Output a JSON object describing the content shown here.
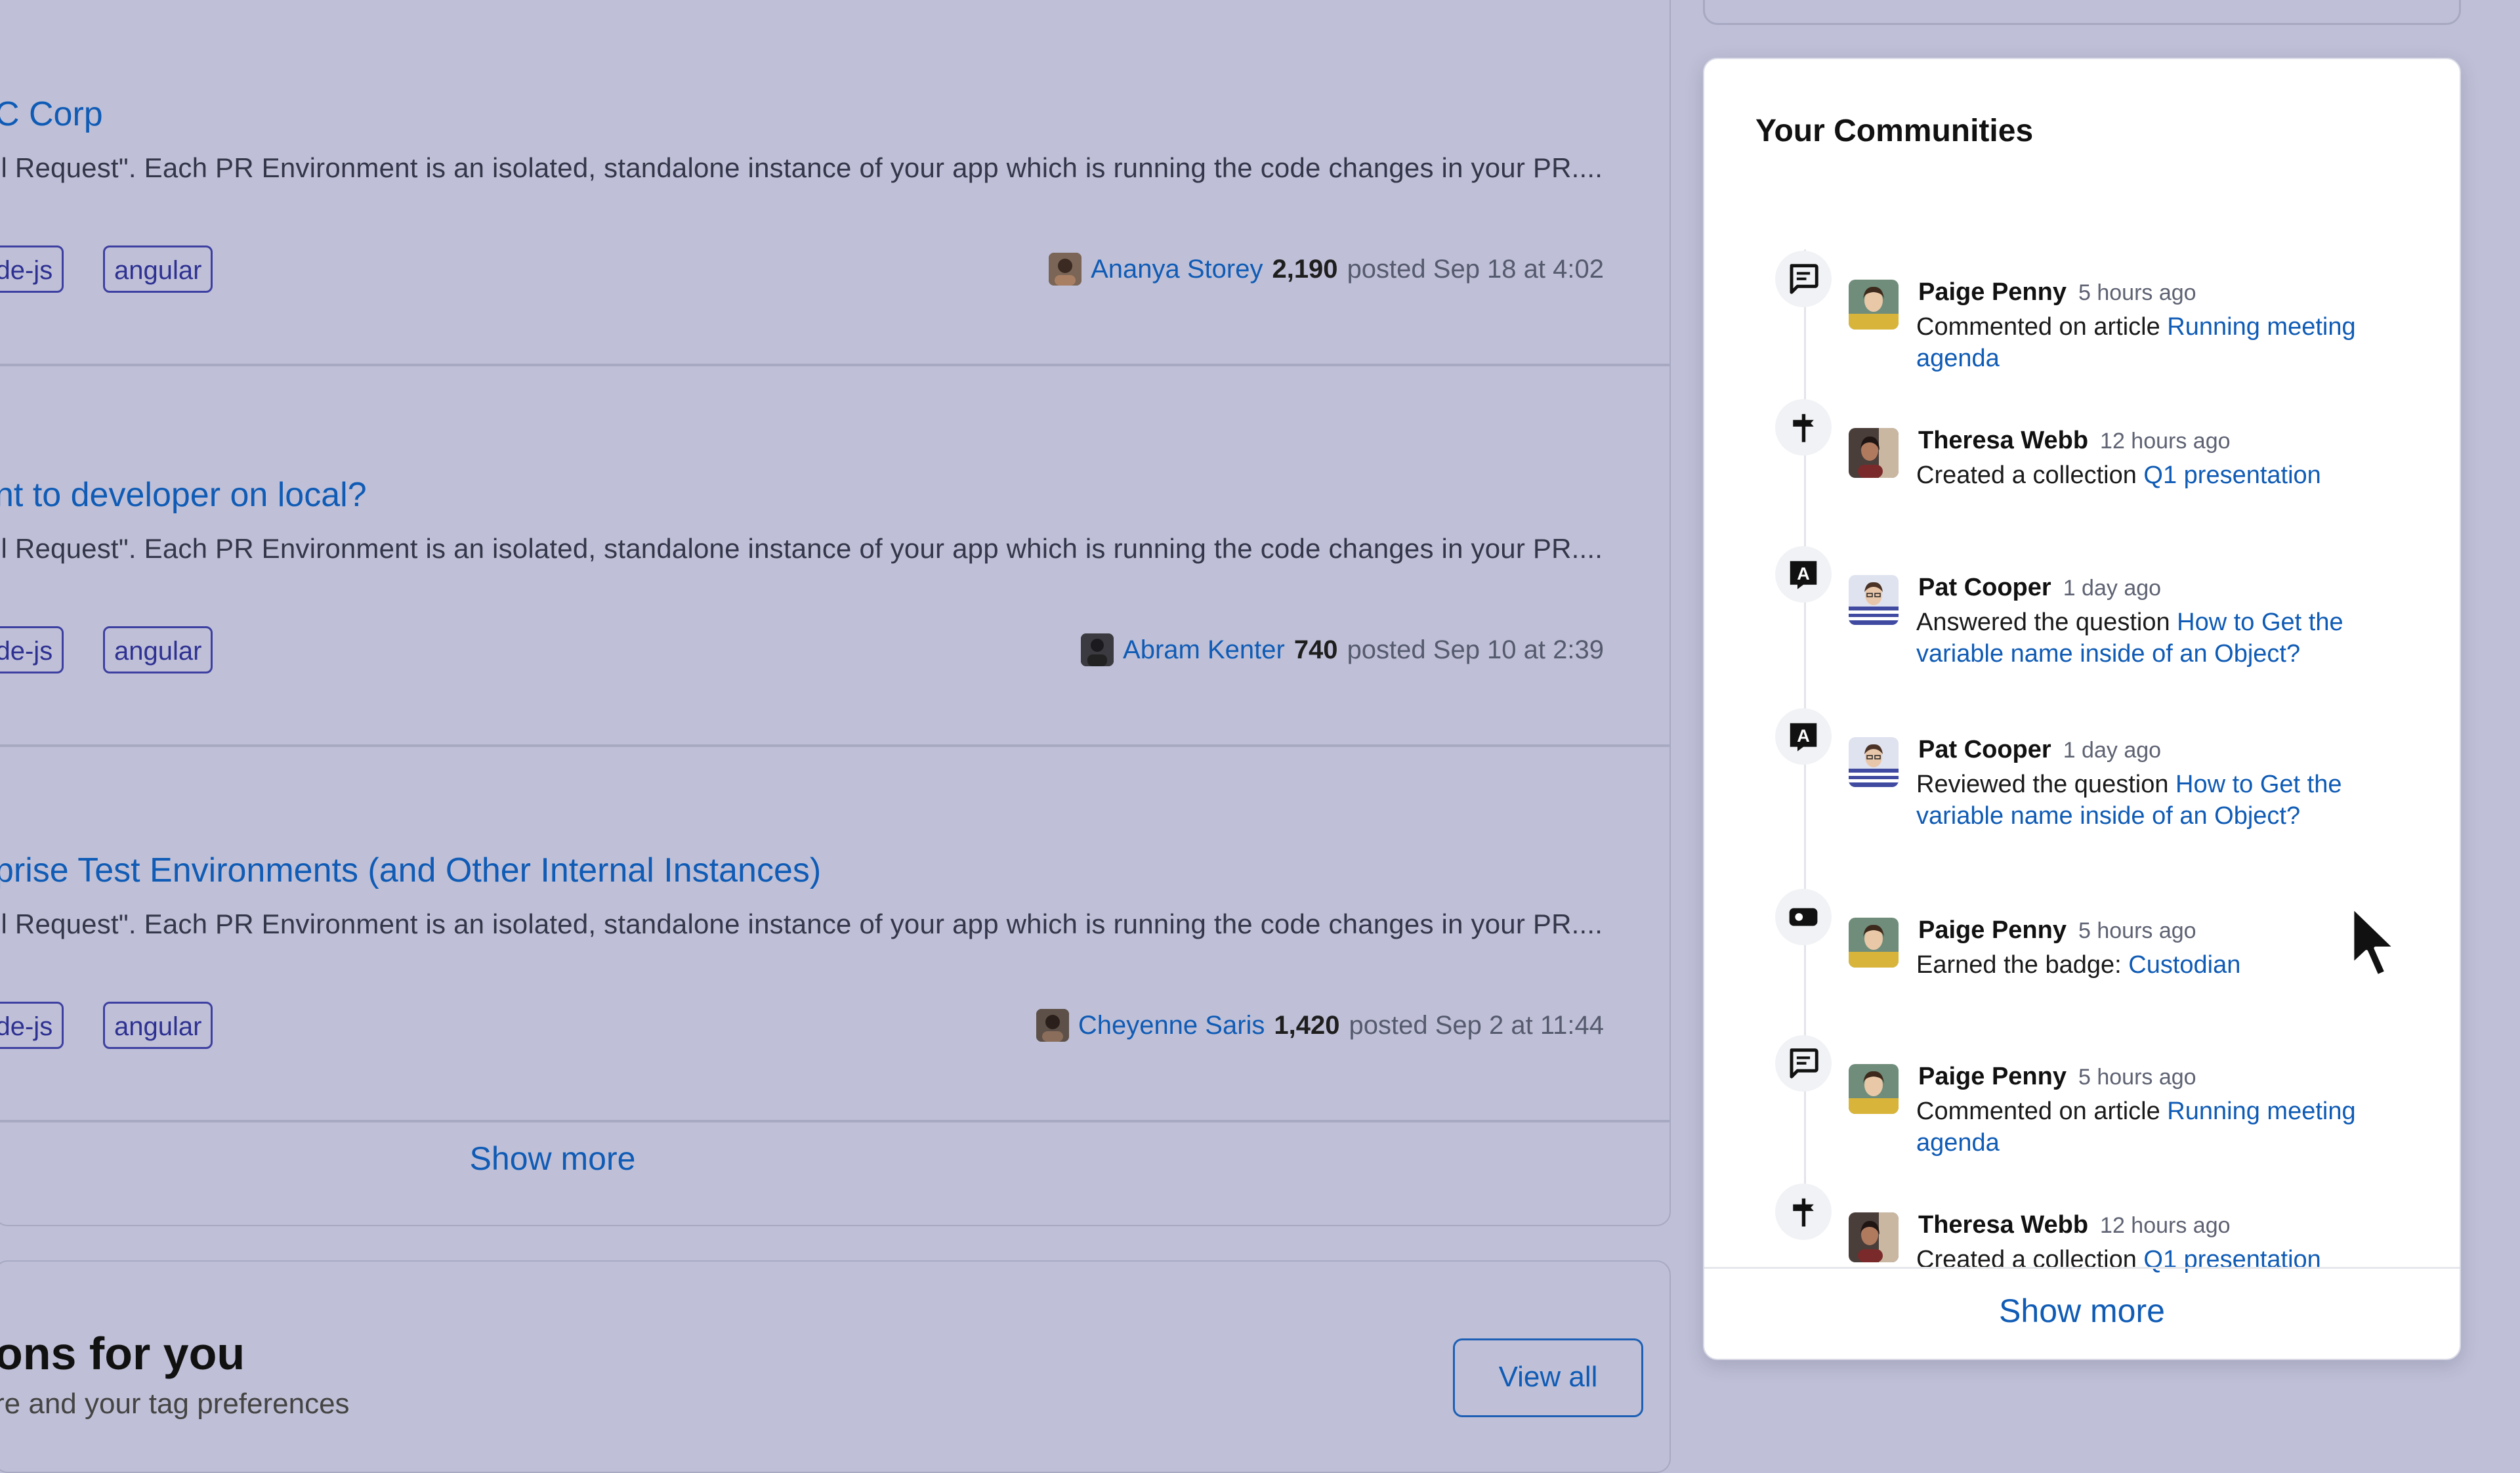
{
  "feed": {
    "posts": [
      {
        "title": "C Corp",
        "excerpt": "ll Request\". Each PR Environment is an isolated, standalone instance of your app which is running the code changes in your PR....",
        "tags": [
          "node-js",
          "angular"
        ],
        "author": "Ananya Storey",
        "reputation": "2,190",
        "posted": "posted Sep 18 at 4:02"
      },
      {
        "title": "nt to developer on local?",
        "excerpt": "ll Request\". Each PR Environment is an isolated, standalone instance of your app which is running the code changes in your PR....",
        "tags": [
          "node-js",
          "angular"
        ],
        "author": "Abram Kenter",
        "reputation": "740",
        "posted": "posted Sep 10 at 2:39"
      },
      {
        "title": "prise Test Environments (and Other Internal Instances)",
        "excerpt": "ll Request\". Each PR Environment is an isolated, standalone instance of your app which is running the code changes in your PR....",
        "tags": [
          "node-js",
          "angular"
        ],
        "author": "Cheyenne Saris",
        "reputation": "1,420",
        "posted": "posted Sep 2 at 11:44"
      }
    ],
    "show_more": "Show more"
  },
  "suggestions": {
    "heading": "ons for you",
    "subheading": "re and your tag preferences",
    "view_all": "View all"
  },
  "communities": {
    "title": "Your Communities",
    "activities": [
      {
        "icon": "comment-icon",
        "name": "Paige Penny",
        "time": "5 hours ago",
        "action": "Commented on article ",
        "link": "Running meeting agenda"
      },
      {
        "icon": "signpost-icon",
        "name": "Theresa Webb",
        "time": "12 hours ago",
        "action": "Created a collection ",
        "link": "Q1 presentation"
      },
      {
        "icon": "answer-icon",
        "name": "Pat Cooper",
        "time": "1 day ago",
        "action": "Answered the question ",
        "link": "How to Get the variable name inside of an Object?"
      },
      {
        "icon": "answer-icon",
        "name": "Pat Cooper",
        "time": "1 day ago",
        "action": "Reviewed the question ",
        "link": "How to Get the variable name inside of an Object?"
      },
      {
        "icon": "badge-icon",
        "name": "Paige Penny",
        "time": "5 hours ago",
        "action": "Earned the badge: ",
        "link": "Custodian"
      },
      {
        "icon": "comment-icon",
        "name": "Paige Penny",
        "time": "5 hours ago",
        "action": "Commented on article ",
        "link": "Running meeting agenda"
      },
      {
        "icon": "signpost-icon",
        "name": "Theresa Webb",
        "time": "12 hours ago",
        "action": "Created a collection ",
        "link": "Q1 presentation"
      }
    ],
    "show_more": "Show more"
  },
  "colors": {
    "overlay_background": "#bfc0d7",
    "link": "#0f5bb5",
    "tag_border": "#3d3fa1",
    "card_background": "#ffffff"
  }
}
